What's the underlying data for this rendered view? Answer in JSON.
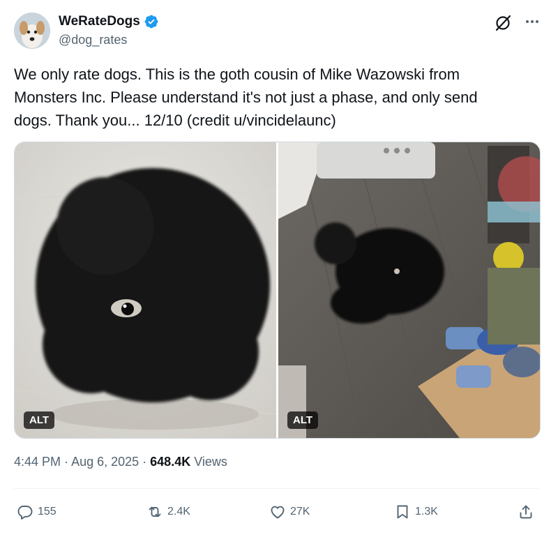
{
  "author": {
    "display_name": "WeRateDogs",
    "handle": "@dog_rates",
    "verified": true,
    "verified_color": "#1d9bf0"
  },
  "tweet": {
    "text": "We only rate dogs. This is the goth cousin of Mike Wazowski from\nMonsters Inc. Please understand it's not just a phase, and only send\ndogs. Thank you... 12/10 (credit u/vincidelaunc)"
  },
  "media": {
    "images": [
      {
        "alt_label": "ALT"
      },
      {
        "alt_label": "ALT"
      }
    ]
  },
  "meta": {
    "time": "4:44 PM",
    "sep1": " · ",
    "date": "Aug 6, 2025",
    "sep2": " · ",
    "views": "648.4K",
    "views_label": " Views"
  },
  "actions": {
    "replies": "155",
    "reposts": "2.4K",
    "likes": "27K",
    "bookmarks": "1.3K"
  },
  "icons": {
    "verified": "verified-badge-icon",
    "grok": "grok-icon",
    "more": "more-icon",
    "reply": "reply-icon",
    "repost": "repost-icon",
    "like": "heart-icon",
    "bookmark": "bookmark-icon",
    "share": "share-icon"
  },
  "colors": {
    "text": "#0f1419",
    "secondary": "#536471",
    "accent": "#1d9bf0"
  }
}
